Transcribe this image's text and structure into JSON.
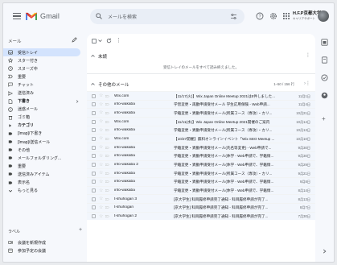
{
  "app": {
    "name": "Gmail"
  },
  "search": {
    "placeholder": "メールを検索"
  },
  "brand": {
    "name": "H.F.P京都大学",
    "sub": "キャリアサポート"
  },
  "sidebar": {
    "compose_label": "メール",
    "items": [
      {
        "label": "受信トレイ",
        "icon": "inbox-icon",
        "active": true
      },
      {
        "label": "スター付き",
        "icon": "star-icon"
      },
      {
        "label": "スヌーズ中",
        "icon": "clock-icon"
      },
      {
        "label": "重要",
        "icon": "important-icon"
      },
      {
        "label": "チャット",
        "icon": "chat-icon"
      },
      {
        "label": "送信済み",
        "icon": "send-icon"
      },
      {
        "label": "下書き",
        "icon": "draft-icon",
        "bold": true
      },
      {
        "label": "迷惑メール",
        "icon": "spam-icon"
      },
      {
        "label": "ゴミ箱",
        "icon": "trash-icon"
      },
      {
        "label": "カテゴリ",
        "icon": "category-icon",
        "bold": true
      },
      {
        "label": "[Imap]/下書き",
        "icon": "label-icon"
      },
      {
        "label": "[Imap]/送信メール",
        "icon": "label-icon"
      },
      {
        "label": "その他",
        "icon": "label-icon"
      },
      {
        "label": "メールフォルダリング...",
        "icon": "label-icon"
      },
      {
        "label": "重要",
        "icon": "label-icon"
      },
      {
        "label": "送信済みアイテム",
        "icon": "label-icon"
      },
      {
        "label": "表示名",
        "icon": "label-icon"
      },
      {
        "label": "もっと見る",
        "icon": "chevron-down-icon"
      }
    ],
    "labels_heading": "ラベル",
    "labels": [
      {
        "label": "会議を新規作成",
        "icon": "video-icon"
      },
      {
        "label": "参加予定の会議",
        "icon": "calendar-icon"
      }
    ]
  },
  "inbox": {
    "section1_title": "未読",
    "empty_message": "受信トレイのメールをすべて読み終えました。",
    "section2_title": "その他のメール",
    "count": "1–50 / 156 行",
    "rows": [
      {
        "sender": "Wix.com",
        "subject": "【11/17(火)】Wix Japan Online Meetup 2021は5件しました...",
        "date": "11月1日"
      },
      {
        "sender": "info-wakaba",
        "subject": "学習変更・再勤申請受付メール 学生応用保険 - Web申請...",
        "date": "11月4日"
      },
      {
        "sender": "info-wakaba",
        "subject": "学籍変更・異動申請受付メール(所属コース（専攻）・カリ...",
        "date": "10月21日"
      },
      {
        "sender": "Wix.com",
        "subject": "【11/11(水)】Wix Japan Online Meetup 2021開催のご案内",
        "date": "10月14日"
      },
      {
        "sender": "info-wakaba",
        "subject": "学籍変更・異動申請受付メール(所属コース（専攻）・カリ...",
        "date": "10月13日"
      },
      {
        "sender": "Wix.com",
        "subject": "【10/27開催】無料オンラインイベント「Wix SEO Meetup ...",
        "date": "10月10日"
      },
      {
        "sender": "info-wakaba",
        "subject": "学籍変更・異動申請受付メール(氏名等変更) - Web申請で...",
        "date": "9月30日"
      },
      {
        "sender": "info-wakaba",
        "subject": "学籍変更・異動申請受付メール(休学 - Web申請で、学籍情...",
        "date": "9月30日"
      },
      {
        "sender": "info-wakaba 2",
        "subject": "学籍変更・異動申請受付メール(休学 - Web申請で、学籍情...",
        "date": "9月29日"
      },
      {
        "sender": "info-wakaba",
        "subject": "学籍変更・異動申請受付メール(所属コース（専攻）・カリ...",
        "date": "9月21日"
      },
      {
        "sender": "info-wakaba",
        "subject": "学籍変更・異動申請受付メール(休学 - Web申請で、学籍情...",
        "date": "9月8日"
      },
      {
        "sender": "info-wakaba",
        "subject": "学籍変更・異動申請受付メール(休学 - Web申請で、学籍情...",
        "date": "8月14日"
      },
      {
        "sender": "t-shuhogan 3",
        "subject": "[京大学生] 科目履修申請完了通知 - 科目履修申請が完了...",
        "date": "8月13日"
      },
      {
        "sender": "t-shuhogan",
        "subject": "[京大学生] 科目履修申請完了通知 - 科目履修申請が完了...",
        "date": "8月7日"
      },
      {
        "sender": "t-shuhogan 2",
        "subject": "[京大学生] 科目履修申請完了通知 - 科目履修申請が完了...",
        "date": "7月30日"
      }
    ]
  }
}
